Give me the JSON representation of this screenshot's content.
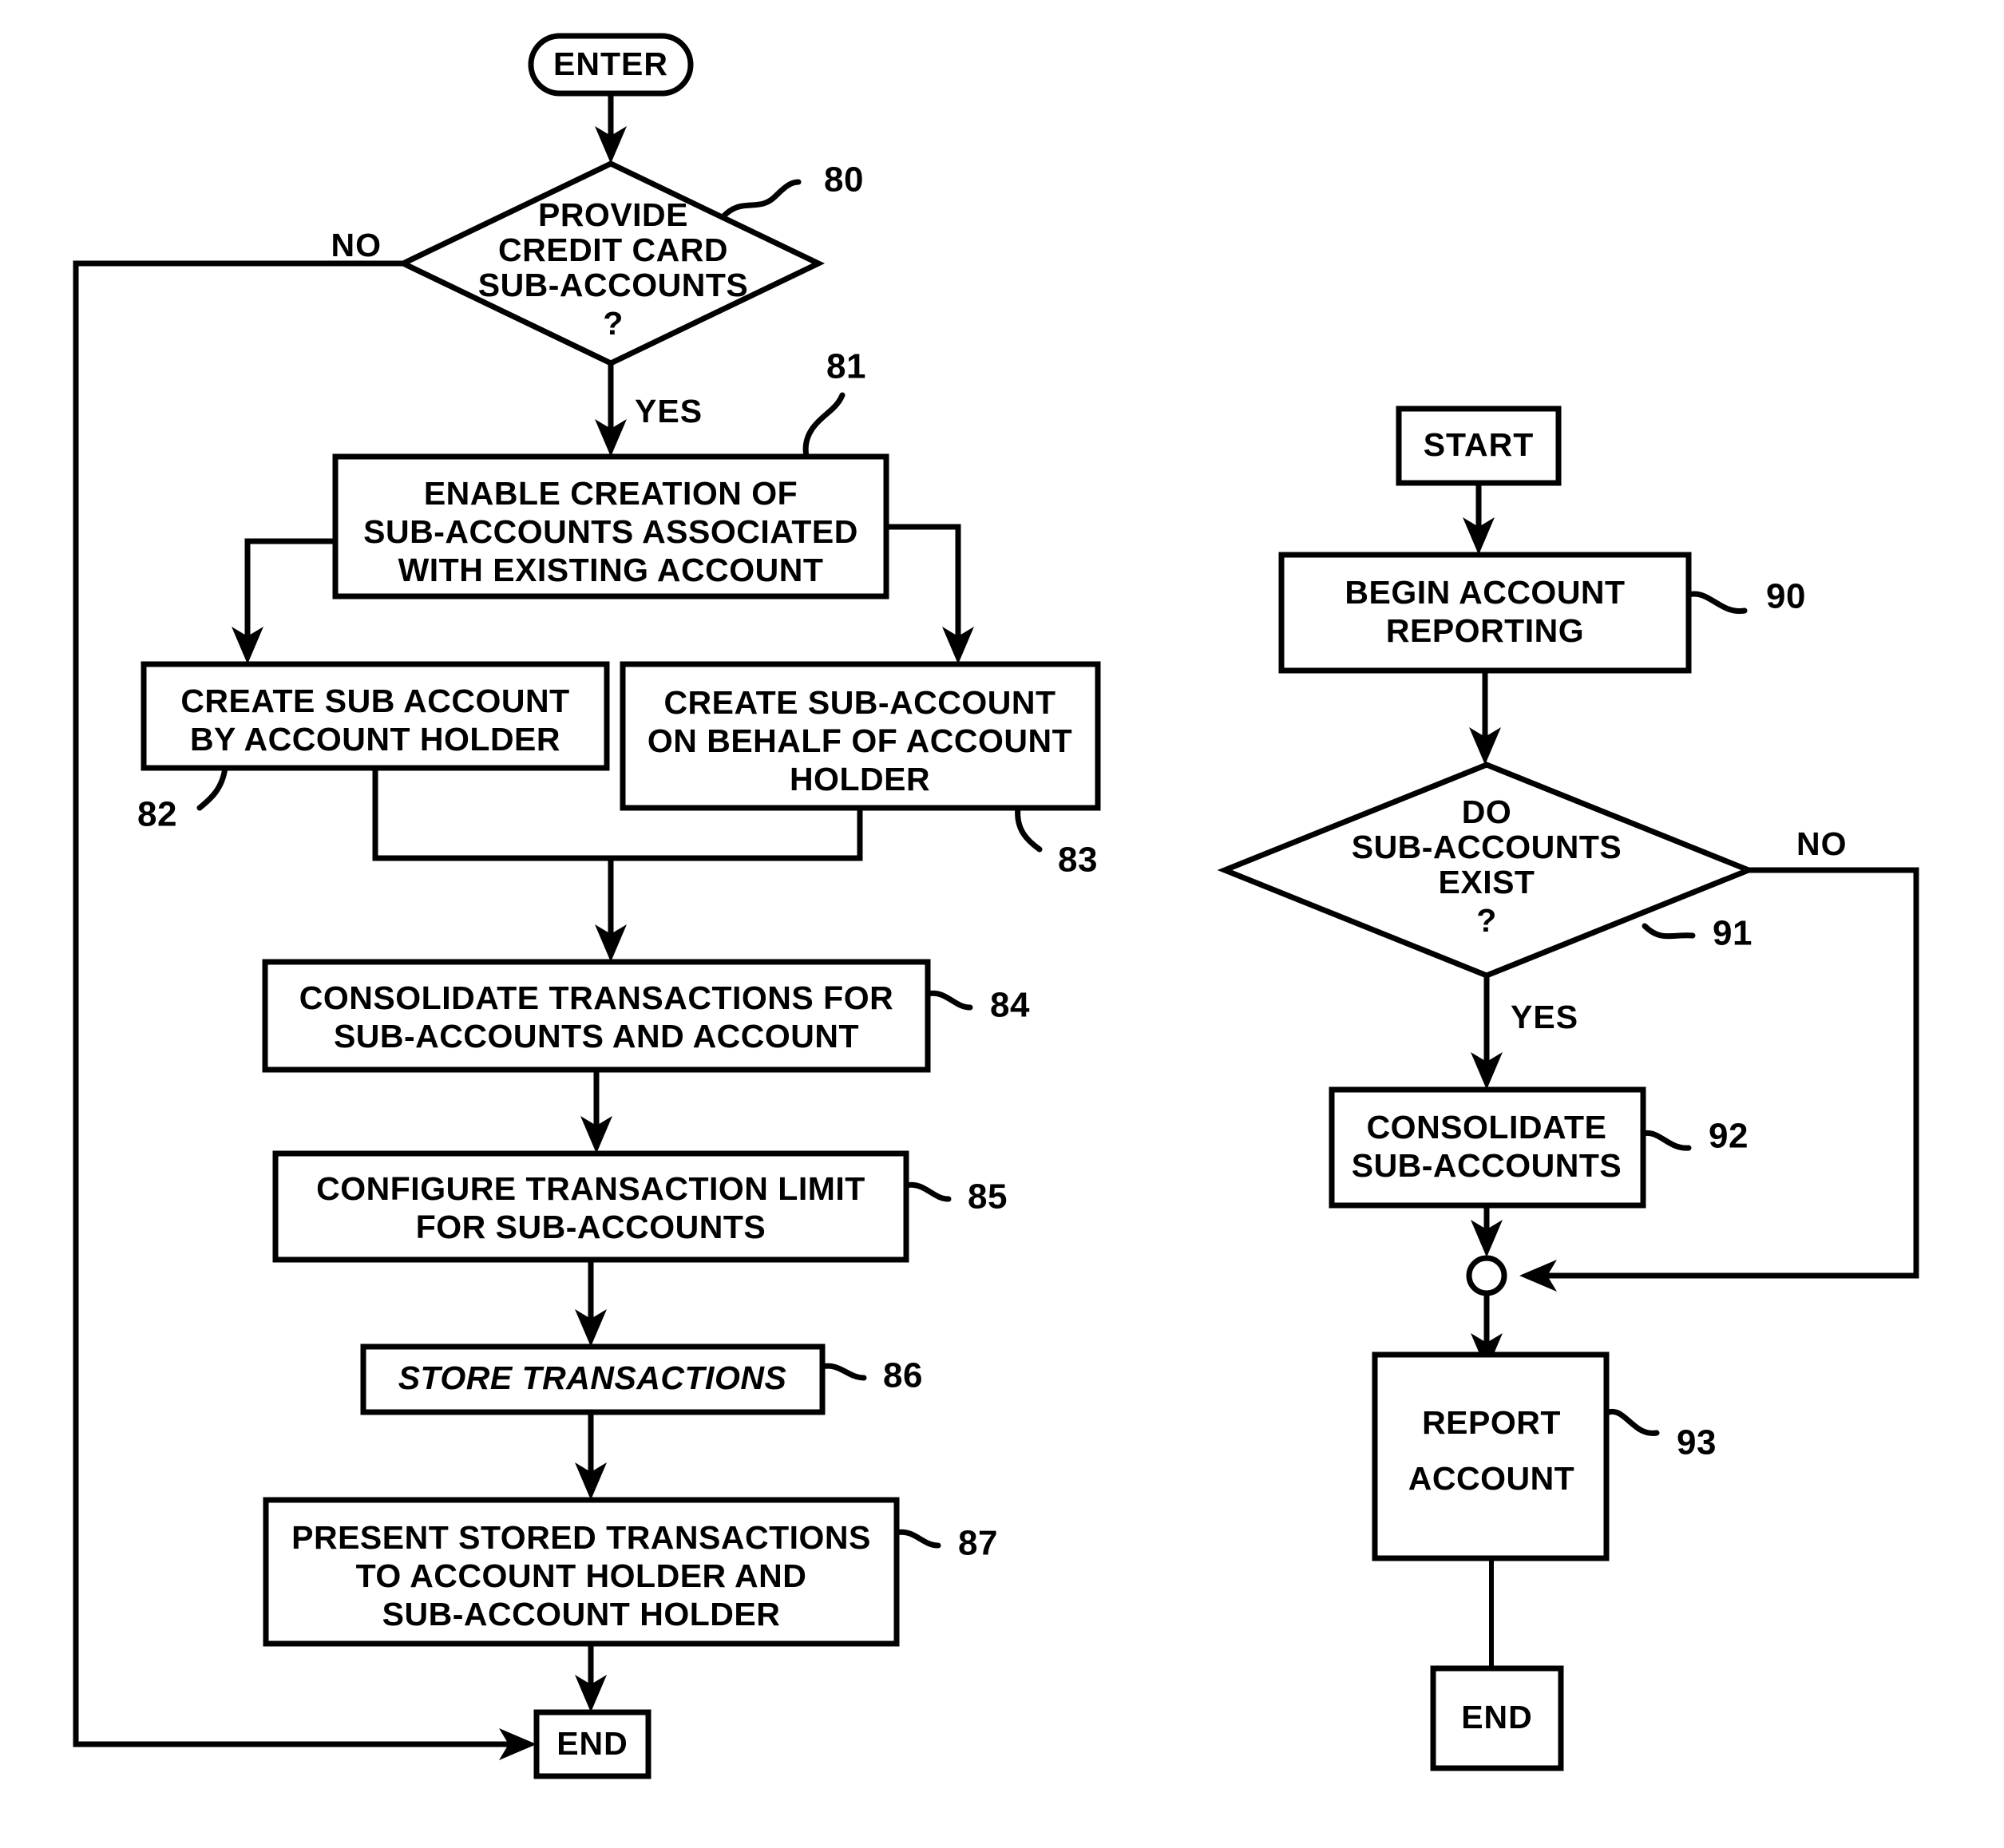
{
  "diagram": {
    "type": "patent-flowchart",
    "background_color": "#ffffff",
    "line_color": "#000000",
    "left_flow": {
      "terminal_enter": "ENTER",
      "terminal_end": "END",
      "decision_80": {
        "ref": "80",
        "line1": "PROVIDE",
        "line2": "CREDIT CARD",
        "line3": "SUB-ACCOUNTS",
        "line4": "?",
        "branch_no": "NO",
        "branch_yes": "YES"
      },
      "box_81": {
        "ref": "81",
        "line1": "ENABLE CREATION OF",
        "line2": "SUB-ACCOUNTS ASSOCIATED",
        "line3": "WITH EXISTING ACCOUNT"
      },
      "box_82": {
        "ref": "82",
        "line1": "CREATE SUB ACCOUNT",
        "line2": "BY ACCOUNT HOLDER"
      },
      "box_83": {
        "ref": "83",
        "line1": "CREATE SUB-ACCOUNT",
        "line2": "ON BEHALF OF ACCOUNT",
        "line3": "HOLDER"
      },
      "box_84": {
        "ref": "84",
        "line1": "CONSOLIDATE TRANSACTIONS FOR",
        "line2": "SUB-ACCOUNTS AND ACCOUNT"
      },
      "box_85": {
        "ref": "85",
        "line1": "CONFIGURE TRANSACTION LIMIT",
        "line2": "FOR SUB-ACCOUNTS"
      },
      "box_86": {
        "ref": "86",
        "line1": "STORE TRANSACTIONS",
        "italic": true
      },
      "box_87": {
        "ref": "87",
        "line1": "PRESENT STORED TRANSACTIONS",
        "line2": "TO ACCOUNT HOLDER AND",
        "line3": "SUB-ACCOUNT HOLDER"
      }
    },
    "right_flow": {
      "terminal_start": "START",
      "terminal_end": "END",
      "box_90": {
        "ref": "90",
        "line1": "BEGIN ACCOUNT",
        "line2": "REPORTING"
      },
      "decision_91": {
        "ref": "91",
        "line1": "DO",
        "line2": "SUB-ACCOUNTS",
        "line3": "EXIST",
        "line4": "?",
        "branch_no": "NO",
        "branch_yes": "YES"
      },
      "box_92": {
        "ref": "92",
        "line1": "CONSOLIDATE",
        "line2": "SUB-ACCOUNTS"
      },
      "box_93": {
        "ref": "93",
        "line1": "REPORT",
        "line2": "ACCOUNT"
      }
    }
  }
}
